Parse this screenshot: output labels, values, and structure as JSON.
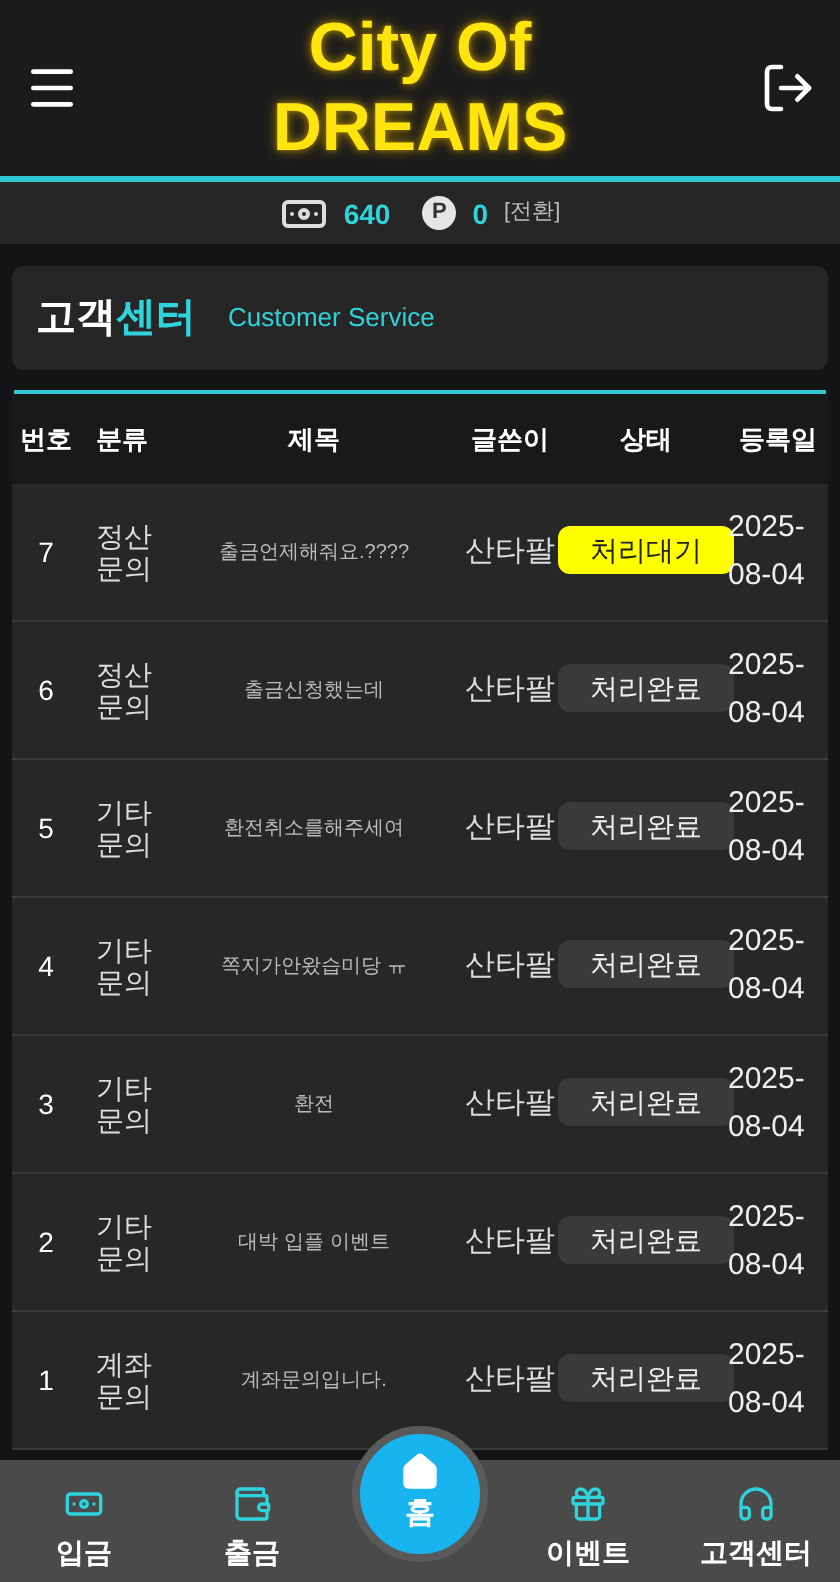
{
  "header": {
    "logo_lines": [
      "City Of",
      "DREAMS"
    ]
  },
  "balance": {
    "money": "640",
    "point_badge": "P",
    "points": "0",
    "convert_link": "[전환]"
  },
  "section": {
    "title_main": "고객",
    "title_accent": "센터",
    "subtitle": "Customer Service"
  },
  "table": {
    "columns": [
      "번호",
      "분류",
      "제목",
      "글쓴이",
      "상태",
      "등록일"
    ],
    "rows": [
      {
        "no": "7",
        "category": "정산 문의",
        "title": "출금언제해줘요.????",
        "author": "산타팔",
        "status": "처리대기",
        "kind": "pending",
        "date": "2025-08-04"
      },
      {
        "no": "6",
        "category": "정산 문의",
        "title": "출금신청했는데",
        "author": "산타팔",
        "status": "처리완료",
        "kind": "done",
        "date": "2025-08-04"
      },
      {
        "no": "5",
        "category": "기타 문의",
        "title": "환전취소를해주세여",
        "author": "산타팔",
        "status": "처리완료",
        "kind": "done",
        "date": "2025-08-04"
      },
      {
        "no": "4",
        "category": "기타 문의",
        "title": "쪽지가안왔습미당 ㅠ",
        "author": "산타팔",
        "status": "처리완료",
        "kind": "done",
        "date": "2025-08-04"
      },
      {
        "no": "3",
        "category": "기타 문의",
        "title": "환전",
        "author": "산타팔",
        "status": "처리완료",
        "kind": "done",
        "date": "2025-08-04"
      },
      {
        "no": "2",
        "category": "기타 문의",
        "title": "대박 입플 이벤트",
        "author": "산타팔",
        "status": "처리완료",
        "kind": "done",
        "date": "2025-08-04"
      },
      {
        "no": "1",
        "category": "계좌 문의",
        "title": "계좌문의입니다.",
        "author": "산타팔",
        "status": "처리완료",
        "kind": "done",
        "date": "2025-08-04"
      }
    ]
  },
  "bottom_nav": [
    {
      "label": "입금",
      "selected": false
    },
    {
      "label": "출금",
      "selected": false
    },
    {
      "label": "홈",
      "selected": true
    },
    {
      "label": "이벤트",
      "selected": false
    },
    {
      "label": "고객센터",
      "selected": false
    }
  ]
}
